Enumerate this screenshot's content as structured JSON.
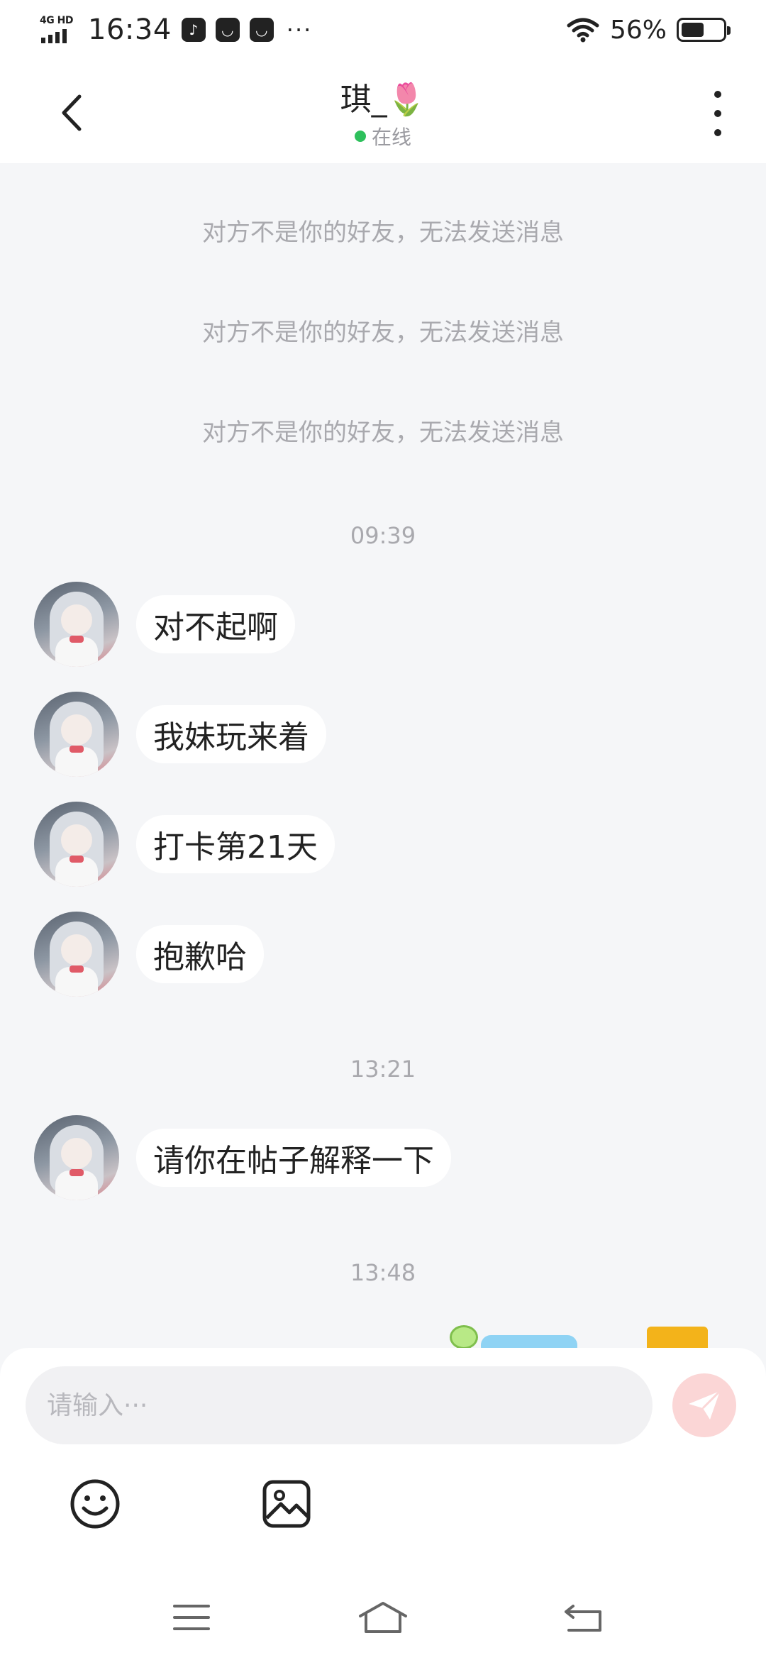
{
  "status_bar": {
    "network": "4G HD",
    "time": "16:34",
    "app_icons": [
      "douyin-icon",
      "taobao-icon",
      "taobao-icon"
    ],
    "more": "···",
    "battery": "56%",
    "battery_level": 0.56
  },
  "header": {
    "title": "琪_🌷",
    "status": "在线"
  },
  "chat": {
    "system_notices": [
      "对方不是你的好友，无法发送消息",
      "对方不是你的好友，无法发送消息",
      "对方不是你的好友，无法发送消息"
    ],
    "time_separators": [
      "09:39",
      "13:21",
      "13:48"
    ],
    "messages": [
      "对不起啊",
      "我妹玩来着",
      "打卡第21天",
      "抱歉哈",
      "请你在帖子解释一下"
    ]
  },
  "input": {
    "placeholder": "请输入···"
  },
  "colors": {
    "online": "#2ec05c",
    "send_button": "#fbd6d6",
    "background": "#f5f6f8"
  }
}
